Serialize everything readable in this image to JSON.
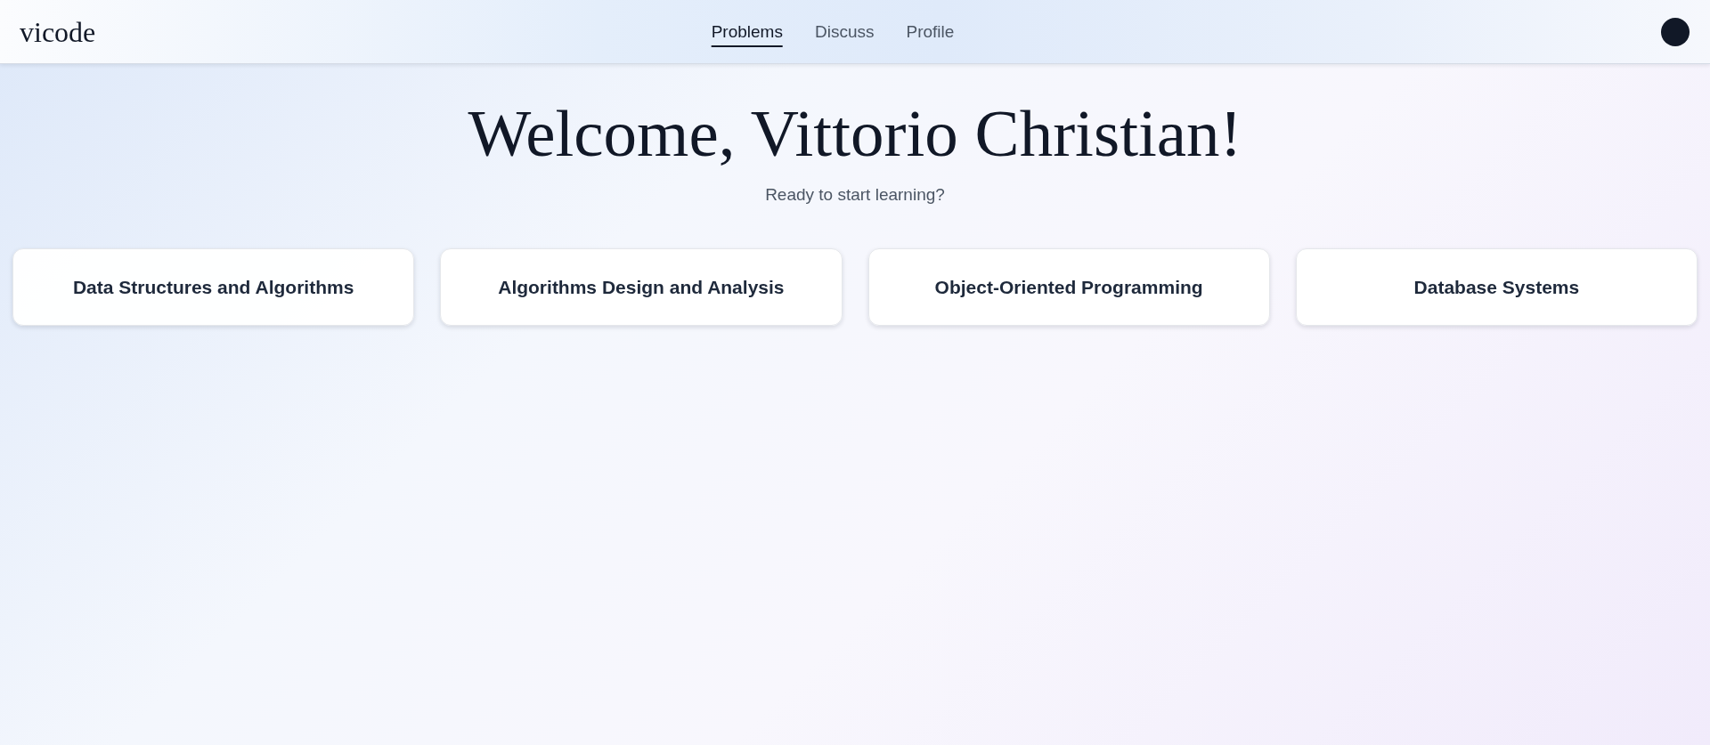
{
  "header": {
    "logo": "vicode",
    "nav": [
      {
        "label": "Problems",
        "selected": true
      },
      {
        "label": "Discuss",
        "selected": false
      },
      {
        "label": "Profile",
        "selected": false
      }
    ]
  },
  "hero": {
    "title": "Welcome, Vittorio Christian!",
    "subtitle": "Ready to start learning?"
  },
  "courses": [
    {
      "title": "Data Structures and Algorithms"
    },
    {
      "title": "Algorithms Design and Analysis"
    },
    {
      "title": "Object-Oriented Programming"
    },
    {
      "title": "Database Systems"
    }
  ]
}
